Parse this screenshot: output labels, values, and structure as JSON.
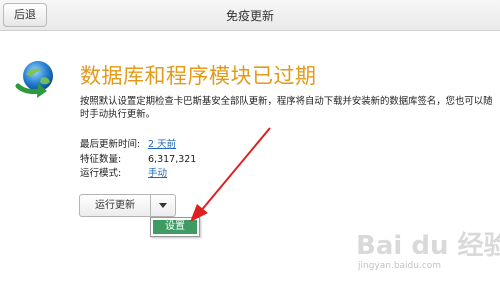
{
  "topbar": {
    "back_label": "后退",
    "title": "免疫更新"
  },
  "main": {
    "heading": "数据库和程序模块已过期",
    "description": "按照默认设置定期检查卡巴斯基安全部队更新，程序将自动下载并安装新的数据库签名，您也可以随时手动执行更新。",
    "info": {
      "last_update_key": "最后更新时间:",
      "last_update_value": "2 天前",
      "signatures_key": "特征数量:",
      "signatures_value": "6,317,321",
      "run_mode_key": "运行模式:",
      "run_mode_value": "手动"
    },
    "run_update_label": "运行更新",
    "menu_item_label": "设置"
  },
  "colors": {
    "heading": "#e39a18",
    "link": "#1f68b8",
    "menu_highlight": "#3e9b64",
    "annotation_arrow": "#e02020"
  },
  "icons": {
    "status": "update-globe-icon",
    "dropdown": "chevron-down-icon"
  },
  "watermark": {
    "logo": "Bai du 经验",
    "url": "jingyan.baidu.com"
  }
}
